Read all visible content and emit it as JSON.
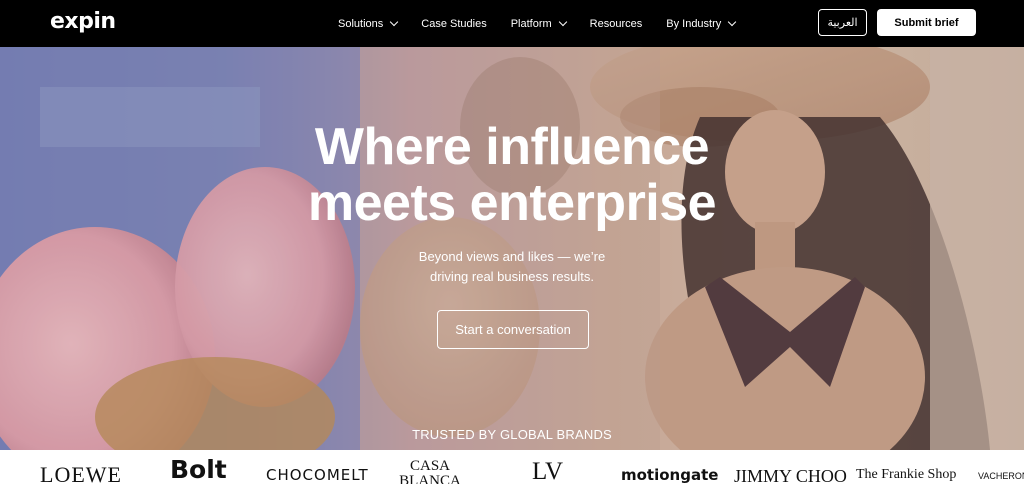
{
  "nav": {
    "logo": "expin",
    "items": [
      {
        "label": "Solutions",
        "dropdown": true
      },
      {
        "label": "Case Studies",
        "dropdown": false
      },
      {
        "label": "Platform",
        "dropdown": true
      },
      {
        "label": "Resources",
        "dropdown": false
      },
      {
        "label": "By Industry",
        "dropdown": true
      }
    ],
    "language_label": "العربية",
    "submit_label": "Submit brief"
  },
  "hero": {
    "headline_line1": "Where influence",
    "headline_line2": "meets enterprise",
    "sub_line1": "Beyond views and likes — we’re",
    "sub_line2": "driving real business results.",
    "cta_label": "Start a conversation",
    "trusted_label": "TRUSTED BY GLOBAL BRANDS"
  },
  "brands": [
    "LOEWE",
    "Bolt",
    "CHOCOMELT",
    "CASA BLANCA",
    "LV",
    "motiongate",
    "JIMMY CHOO",
    "The Frankie Shop",
    "VACHERON C"
  ],
  "colors": {
    "nav_bg": "#000000",
    "button_bg": "#ffffff",
    "text_light": "#ffffff"
  }
}
